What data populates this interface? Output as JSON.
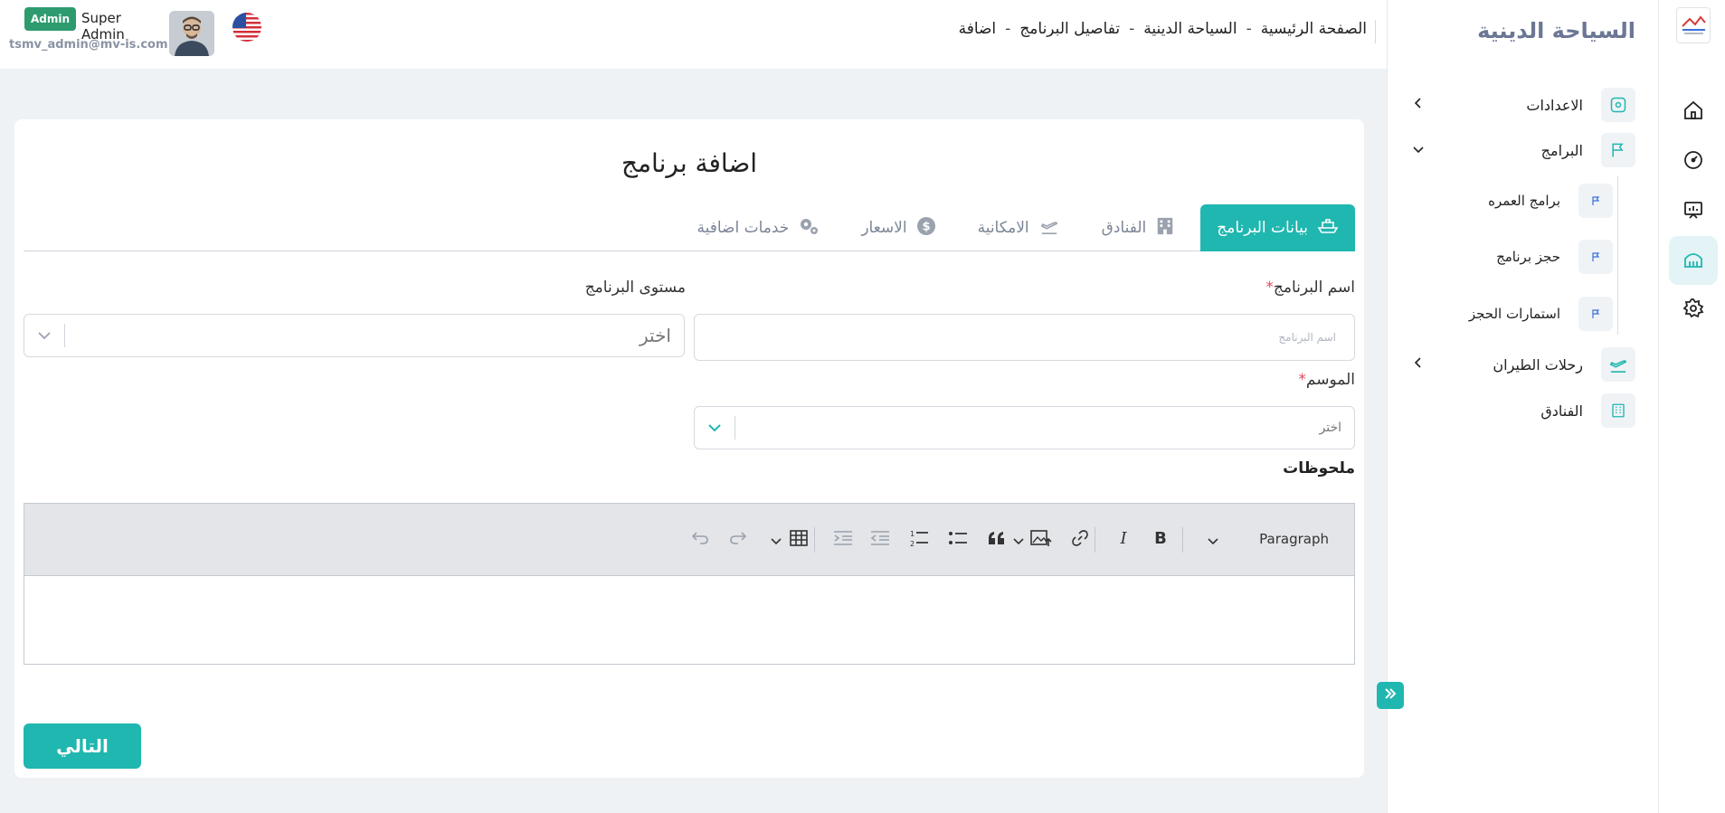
{
  "header": {
    "user_role_badge": "Admin",
    "user_name": "Super Admin",
    "user_email": "tsmv_admin@mv-is.com",
    "breadcrumb": [
      "الصفحة الرئيسية",
      "السياحة الدينية",
      "تفاصيل البرنامج",
      "اضافة"
    ],
    "breadcrumb_sep": "-"
  },
  "sidebar": {
    "title": "السياحة الدينية",
    "items": [
      {
        "label": "الاعدادات",
        "icon": "gear-icon",
        "chevron": "›"
      },
      {
        "label": "البرامج",
        "icon": "flag-icon",
        "chevron": "⌄"
      },
      {
        "label": "رحلات الطيران",
        "icon": "plane-icon",
        "chevron": "›"
      },
      {
        "label": "الفنادق",
        "icon": "hotel-icon",
        "chevron": ""
      }
    ],
    "sub_items": [
      {
        "label": "برامج العمره",
        "icon": "flag-small-icon"
      },
      {
        "label": "حجز برنامج",
        "icon": "flag-small-icon"
      },
      {
        "label": "استمارات الحجز",
        "icon": "flag-small-icon"
      }
    ]
  },
  "rail": {
    "icons": [
      "home-icon",
      "dashboard-gauge-icon",
      "presentation-icon",
      "mosque-icon",
      "settings-icon"
    ],
    "active_index": 3
  },
  "page": {
    "title": "اضافة برنامج",
    "tabs": [
      {
        "label": "بيانات البرنامج",
        "icon": "ship-icon",
        "active": true
      },
      {
        "label": "الفنادق",
        "icon": "building-icon",
        "active": false
      },
      {
        "label": "الامكانية",
        "icon": "plane-icon",
        "active": false
      },
      {
        "label": "الاسعار",
        "icon": "dollar-icon",
        "active": false
      },
      {
        "label": "خدمات اضافية",
        "icon": "gears-icon",
        "active": false
      }
    ],
    "form": {
      "program_name_label": "اسم البرنامج",
      "program_name_placeholder": "اسم البرنامج",
      "program_level_label": "مستوى البرنامج",
      "program_level_value": "اختر",
      "season_label": "الموسم",
      "season_value": "اختر",
      "required_mark": "*",
      "notes_label": "ملحوظات"
    },
    "editor": {
      "paragraph_label": "Paragraph"
    },
    "next_button": "التالي"
  },
  "colors": {
    "accent": "#1fb7b0",
    "admin_badge": "#2e9b6f",
    "required": "#e6485e",
    "sidebar_title": "#6c7695"
  }
}
